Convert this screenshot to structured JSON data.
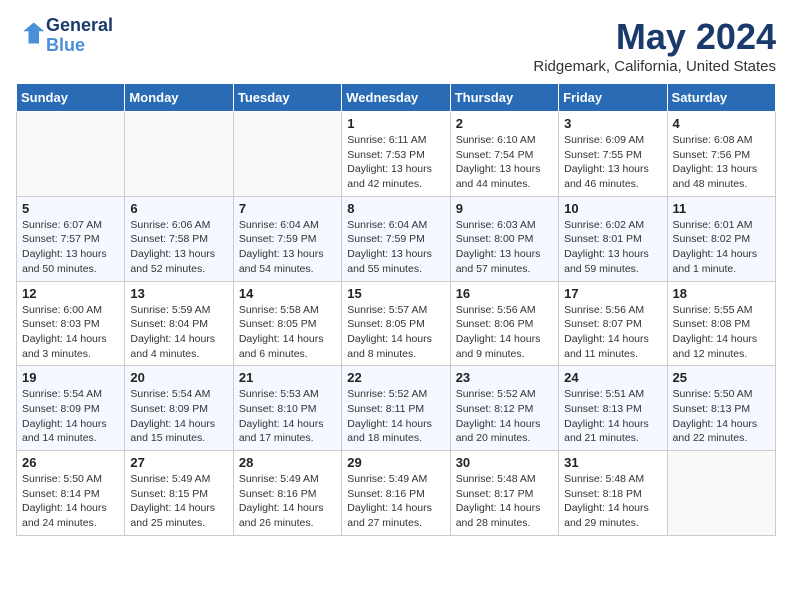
{
  "header": {
    "logo_line1": "General",
    "logo_line2": "Blue",
    "title": "May 2024",
    "location": "Ridgemark, California, United States"
  },
  "weekdays": [
    "Sunday",
    "Monday",
    "Tuesday",
    "Wednesday",
    "Thursday",
    "Friday",
    "Saturday"
  ],
  "weeks": [
    [
      {
        "day": "",
        "info": ""
      },
      {
        "day": "",
        "info": ""
      },
      {
        "day": "",
        "info": ""
      },
      {
        "day": "1",
        "info": "Sunrise: 6:11 AM\nSunset: 7:53 PM\nDaylight: 13 hours\nand 42 minutes."
      },
      {
        "day": "2",
        "info": "Sunrise: 6:10 AM\nSunset: 7:54 PM\nDaylight: 13 hours\nand 44 minutes."
      },
      {
        "day": "3",
        "info": "Sunrise: 6:09 AM\nSunset: 7:55 PM\nDaylight: 13 hours\nand 46 minutes."
      },
      {
        "day": "4",
        "info": "Sunrise: 6:08 AM\nSunset: 7:56 PM\nDaylight: 13 hours\nand 48 minutes."
      }
    ],
    [
      {
        "day": "5",
        "info": "Sunrise: 6:07 AM\nSunset: 7:57 PM\nDaylight: 13 hours\nand 50 minutes."
      },
      {
        "day": "6",
        "info": "Sunrise: 6:06 AM\nSunset: 7:58 PM\nDaylight: 13 hours\nand 52 minutes."
      },
      {
        "day": "7",
        "info": "Sunrise: 6:04 AM\nSunset: 7:59 PM\nDaylight: 13 hours\nand 54 minutes."
      },
      {
        "day": "8",
        "info": "Sunrise: 6:04 AM\nSunset: 7:59 PM\nDaylight: 13 hours\nand 55 minutes."
      },
      {
        "day": "9",
        "info": "Sunrise: 6:03 AM\nSunset: 8:00 PM\nDaylight: 13 hours\nand 57 minutes."
      },
      {
        "day": "10",
        "info": "Sunrise: 6:02 AM\nSunset: 8:01 PM\nDaylight: 13 hours\nand 59 minutes."
      },
      {
        "day": "11",
        "info": "Sunrise: 6:01 AM\nSunset: 8:02 PM\nDaylight: 14 hours\nand 1 minute."
      }
    ],
    [
      {
        "day": "12",
        "info": "Sunrise: 6:00 AM\nSunset: 8:03 PM\nDaylight: 14 hours\nand 3 minutes."
      },
      {
        "day": "13",
        "info": "Sunrise: 5:59 AM\nSunset: 8:04 PM\nDaylight: 14 hours\nand 4 minutes."
      },
      {
        "day": "14",
        "info": "Sunrise: 5:58 AM\nSunset: 8:05 PM\nDaylight: 14 hours\nand 6 minutes."
      },
      {
        "day": "15",
        "info": "Sunrise: 5:57 AM\nSunset: 8:05 PM\nDaylight: 14 hours\nand 8 minutes."
      },
      {
        "day": "16",
        "info": "Sunrise: 5:56 AM\nSunset: 8:06 PM\nDaylight: 14 hours\nand 9 minutes."
      },
      {
        "day": "17",
        "info": "Sunrise: 5:56 AM\nSunset: 8:07 PM\nDaylight: 14 hours\nand 11 minutes."
      },
      {
        "day": "18",
        "info": "Sunrise: 5:55 AM\nSunset: 8:08 PM\nDaylight: 14 hours\nand 12 minutes."
      }
    ],
    [
      {
        "day": "19",
        "info": "Sunrise: 5:54 AM\nSunset: 8:09 PM\nDaylight: 14 hours\nand 14 minutes."
      },
      {
        "day": "20",
        "info": "Sunrise: 5:54 AM\nSunset: 8:09 PM\nDaylight: 14 hours\nand 15 minutes."
      },
      {
        "day": "21",
        "info": "Sunrise: 5:53 AM\nSunset: 8:10 PM\nDaylight: 14 hours\nand 17 minutes."
      },
      {
        "day": "22",
        "info": "Sunrise: 5:52 AM\nSunset: 8:11 PM\nDaylight: 14 hours\nand 18 minutes."
      },
      {
        "day": "23",
        "info": "Sunrise: 5:52 AM\nSunset: 8:12 PM\nDaylight: 14 hours\nand 20 minutes."
      },
      {
        "day": "24",
        "info": "Sunrise: 5:51 AM\nSunset: 8:13 PM\nDaylight: 14 hours\nand 21 minutes."
      },
      {
        "day": "25",
        "info": "Sunrise: 5:50 AM\nSunset: 8:13 PM\nDaylight: 14 hours\nand 22 minutes."
      }
    ],
    [
      {
        "day": "26",
        "info": "Sunrise: 5:50 AM\nSunset: 8:14 PM\nDaylight: 14 hours\nand 24 minutes."
      },
      {
        "day": "27",
        "info": "Sunrise: 5:49 AM\nSunset: 8:15 PM\nDaylight: 14 hours\nand 25 minutes."
      },
      {
        "day": "28",
        "info": "Sunrise: 5:49 AM\nSunset: 8:16 PM\nDaylight: 14 hours\nand 26 minutes."
      },
      {
        "day": "29",
        "info": "Sunrise: 5:49 AM\nSunset: 8:16 PM\nDaylight: 14 hours\nand 27 minutes."
      },
      {
        "day": "30",
        "info": "Sunrise: 5:48 AM\nSunset: 8:17 PM\nDaylight: 14 hours\nand 28 minutes."
      },
      {
        "day": "31",
        "info": "Sunrise: 5:48 AM\nSunset: 8:18 PM\nDaylight: 14 hours\nand 29 minutes."
      },
      {
        "day": "",
        "info": ""
      }
    ]
  ]
}
